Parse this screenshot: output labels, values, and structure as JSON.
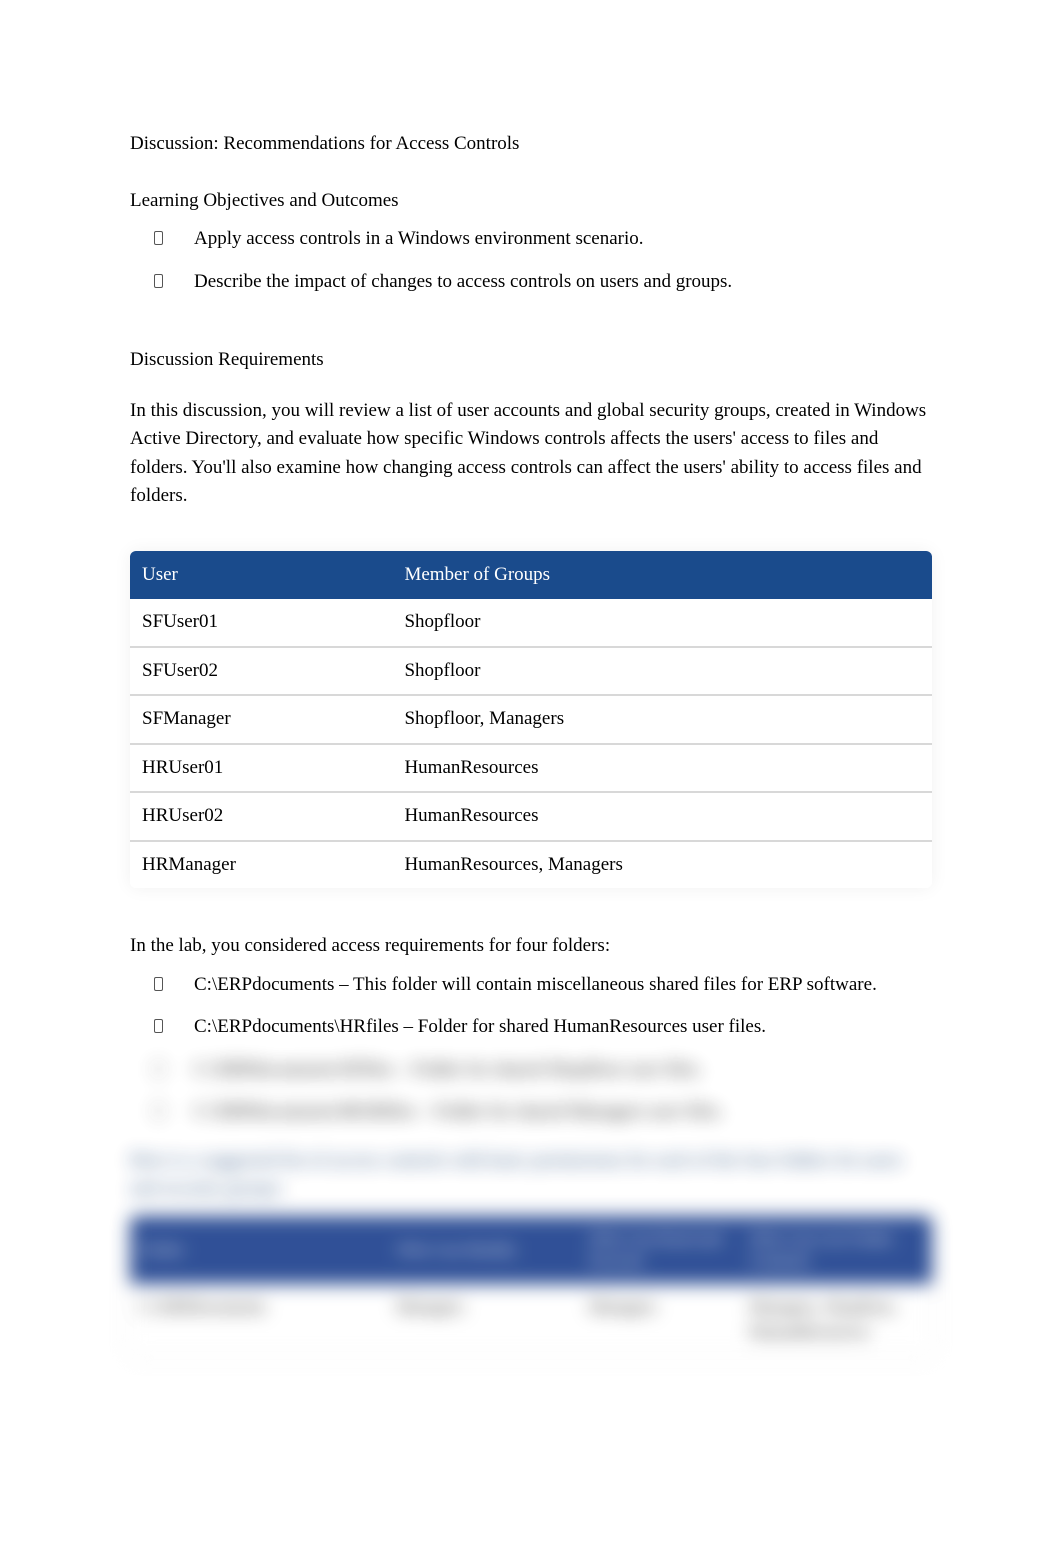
{
  "title": "Discussion: Recommendations for Access Controls",
  "subheading1": "Learning Objectives and Outcomes",
  "objectives": [
    "Apply access controls in a Windows environment scenario.",
    "Describe the impact of changes to access controls on users and groups."
  ],
  "subheading2": "Discussion Requirements",
  "intro_paragraph": "In this discussion, you will review a list of user accounts and global security groups, created in Windows Active Directory, and evaluate how specific Windows controls affects the users' access to files and folders. You'll also examine how changing access controls can affect the users' ability to access files and folders.",
  "table1": {
    "headers": [
      "User",
      "Member of Groups"
    ],
    "rows": [
      [
        "SFUser01",
        "Shopfloor"
      ],
      [
        "SFUser02",
        "Shopfloor"
      ],
      [
        "SFManager",
        "Shopfloor, Managers"
      ],
      [
        "HRUser01",
        "HumanResources"
      ],
      [
        "HRUser02",
        "HumanResources"
      ],
      [
        "HRManager",
        "HumanResources, Managers"
      ]
    ]
  },
  "lab_intro": "In the lab, you considered access requirements for four folders:",
  "folder_list": [
    "C:\\ERPdocuments – This folder will contain miscellaneous shared files for ERP software.",
    "C:\\ERPdocuments\\HRfiles – Folder for shared HumanResources user files.",
    "C:\\ERPdocuments\\SFfiles – Folder for shared Shopfloor user files.",
    "C:\\ERPdocuments\\MGRfiles – Folder for shared Managers user files."
  ],
  "blurred_para": "Here is a suggested list of access controls with basic permissions for each of the four folders for users and security groups:",
  "table2": {
    "headers": [
      "Folder",
      "Who Can Modify",
      "Who Can Read and Execute",
      "Who Can List Folder Contents"
    ],
    "rows": [
      [
        "C:\\ERPdocuments",
        "Managers",
        "Managers",
        "Managers, Shopfloor, HumanResources"
      ]
    ]
  }
}
